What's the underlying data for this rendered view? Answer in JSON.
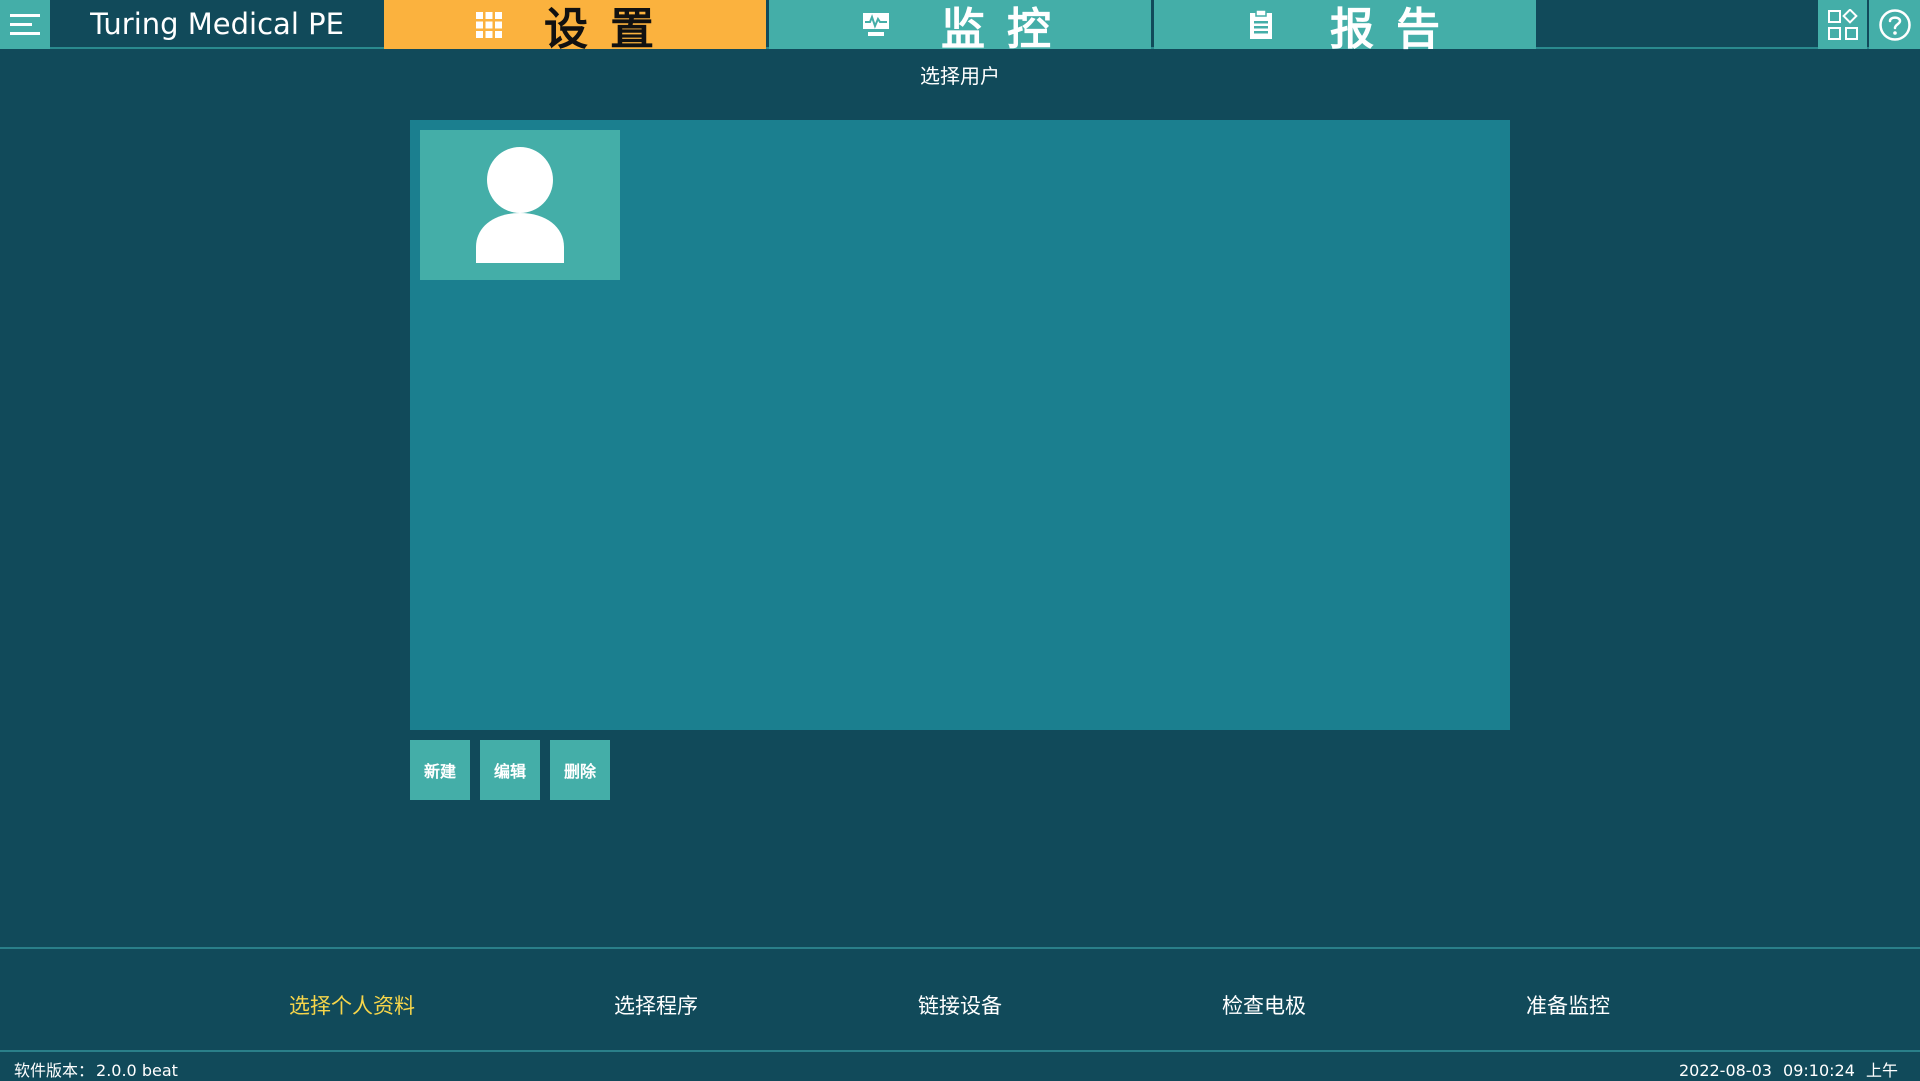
{
  "header": {
    "app_title": "Turing Medical PE",
    "tabs": [
      {
        "label": "设置",
        "icon": "grid-icon",
        "active": true
      },
      {
        "label": "监控",
        "icon": "monitor-icon",
        "active": false
      },
      {
        "label": "报告",
        "icon": "clipboard-icon",
        "active": false
      }
    ],
    "icons": {
      "menu": "hamburger-menu-icon",
      "apps": "apps-grid-icon",
      "help": "help-circle-icon"
    }
  },
  "main": {
    "title": "选择用户",
    "users": [
      {
        "avatar": "user-avatar-icon"
      }
    ],
    "actions": {
      "new_label": "新建",
      "edit_label": "编辑",
      "delete_label": "删除"
    }
  },
  "steps": [
    {
      "label": "选择个人资料",
      "active": true
    },
    {
      "label": "选择程序",
      "active": false
    },
    {
      "label": "链接设备",
      "active": false
    },
    {
      "label": "检查电极",
      "active": false
    },
    {
      "label": "准备监控",
      "active": false
    }
  ],
  "status": {
    "version_label": "软件版本：",
    "version_value": "2.0.0 beat",
    "date": "2022-08-03",
    "time": "09:10:24",
    "ampm": "上午"
  },
  "colors": {
    "background": "#114a5a",
    "teal_accent": "#44aea8",
    "panel": "#1b7f8f",
    "active_tab": "#fbb23e",
    "active_step_text": "#f7d54a"
  }
}
